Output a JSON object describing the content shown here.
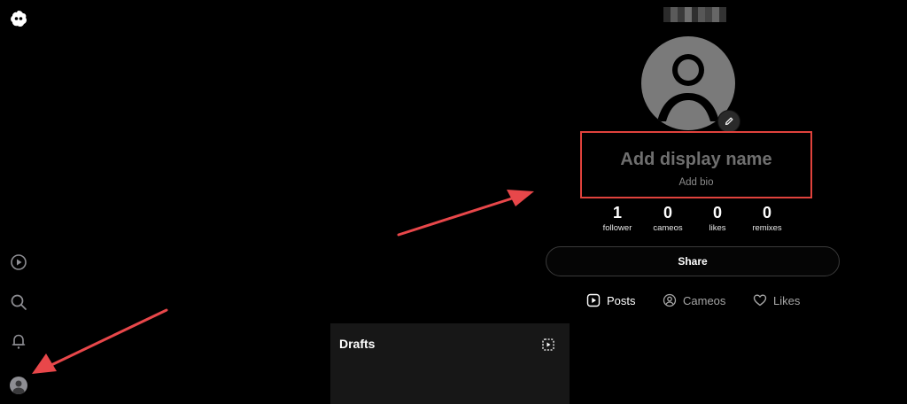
{
  "app": {
    "logo_icon": "app-logo-icon"
  },
  "left_rail": {
    "items": [
      {
        "icon": "play-square-icon"
      },
      {
        "icon": "search-icon"
      },
      {
        "icon": "bell-icon"
      },
      {
        "icon": "profile-avatar-icon"
      }
    ]
  },
  "profile": {
    "display_name_placeholder": "Add display name",
    "bio_placeholder": "Add bio",
    "stats": [
      {
        "value": "1",
        "label": "follower"
      },
      {
        "value": "0",
        "label": "cameos"
      },
      {
        "value": "0",
        "label": "likes"
      },
      {
        "value": "0",
        "label": "remixes"
      }
    ],
    "share_label": "Share"
  },
  "tabs": [
    {
      "label": "Posts",
      "icon": "play-square-icon",
      "active": true
    },
    {
      "label": "Cameos",
      "icon": "person-circle-icon",
      "active": false
    },
    {
      "label": "Likes",
      "icon": "heart-icon",
      "active": false
    }
  ],
  "drafts": {
    "title": "Drafts"
  },
  "colors": {
    "background": "#000000",
    "highlight_box": "#e0423c",
    "arrow": "#e8474a",
    "placeholder_text": "#6f6f6f"
  }
}
